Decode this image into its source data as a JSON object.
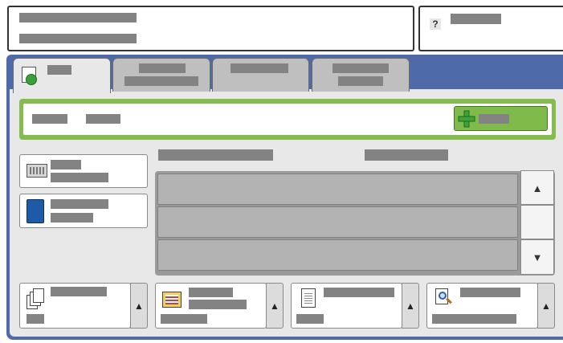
{
  "header": {
    "title_line1": "",
    "title_line2": "",
    "help": {
      "icon": "?",
      "label": ""
    }
  },
  "tabs": [
    {
      "label": "",
      "icon": "phone-icon",
      "active": true
    },
    {
      "label": "",
      "active": false
    },
    {
      "label": "",
      "active": false
    },
    {
      "label": "",
      "active": false
    }
  ],
  "entry": {
    "field_label_1": "",
    "field_label_2": "",
    "add_button_label": ""
  },
  "sidebar": [
    {
      "icon": "keyboard-icon",
      "label": ""
    },
    {
      "icon": "address-book-icon",
      "label": ""
    }
  ],
  "list": {
    "column_1": "",
    "column_2": "",
    "rows": [
      "",
      "",
      ""
    ],
    "scroll_up": "▲",
    "scroll_down": "▼"
  },
  "bottom_buttons": [
    {
      "icon": "pages-icon",
      "label": "",
      "value": "",
      "arrow": "▲"
    },
    {
      "icon": "resolution-icon",
      "label": "",
      "value": "",
      "arrow": "▲"
    },
    {
      "icon": "document-icon",
      "label": "",
      "value": "",
      "arrow": "▲"
    },
    {
      "icon": "preview-icon",
      "label": "",
      "value": "",
      "arrow": "▲"
    }
  ],
  "colors": {
    "frame_blue": "#4f6aa8",
    "entry_green": "#86bc4f",
    "add_green": "#7fba4a",
    "redacted_gray": "#838383"
  }
}
